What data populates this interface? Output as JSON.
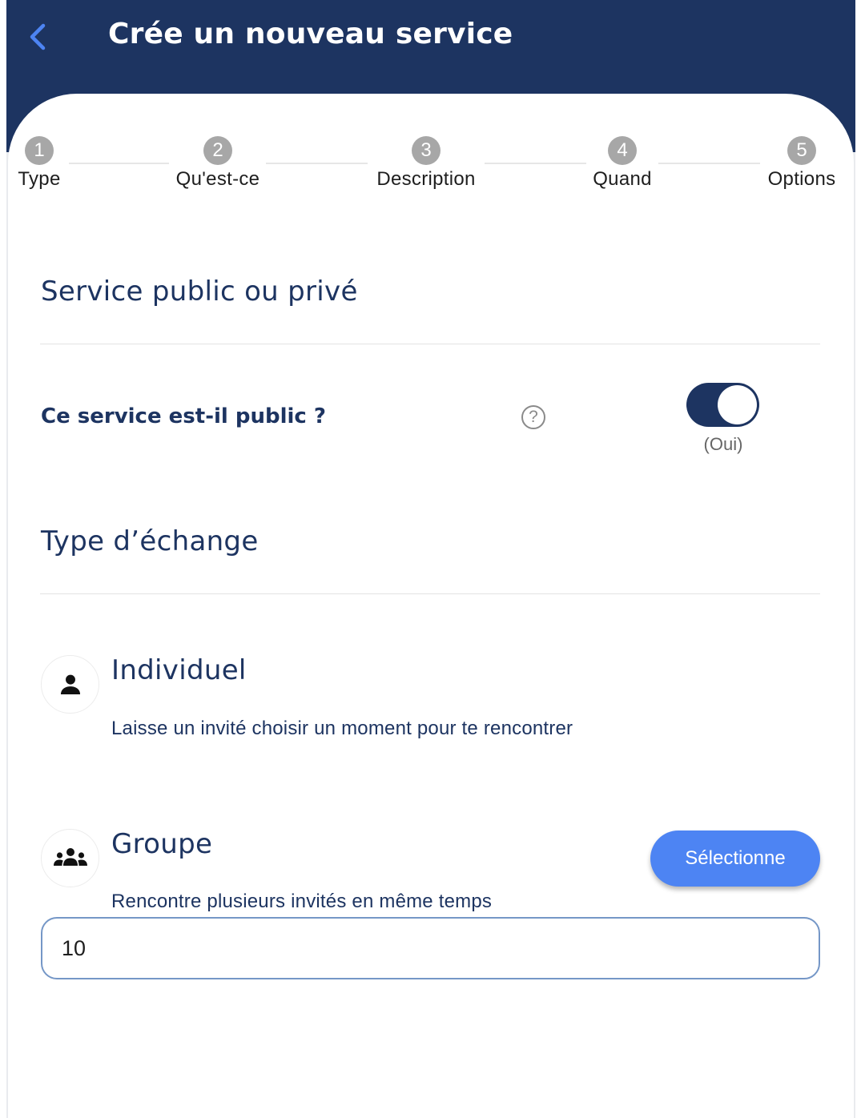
{
  "header": {
    "title": "Crée un nouveau service",
    "back_icon": "chevron-left-icon",
    "background": "#1d3461",
    "back_color": "#4d84f3"
  },
  "stepper": {
    "steps": [
      {
        "number": "1",
        "label": "Type"
      },
      {
        "number": "2",
        "label": "Qu'est-ce"
      },
      {
        "number": "3",
        "label": "Description"
      },
      {
        "number": "4",
        "label": "Quand"
      },
      {
        "number": "5",
        "label": "Options"
      }
    ]
  },
  "visibility": {
    "section_title": "Service public ou privé",
    "question": "Ce service est-il public ?",
    "help_icon": "help-circle-icon",
    "help_symbol": "?",
    "toggle_on": true,
    "toggle_state": "(Oui)"
  },
  "exchange": {
    "section_title": "Type d’échange",
    "options": [
      {
        "title": "Individuel",
        "description": "Laisse un invité choisir un moment pour te rencontrer",
        "icon": "person-icon"
      },
      {
        "title": "Groupe",
        "description": "Rencontre plusieurs invités en même temps",
        "icon": "group-icon",
        "button_label": "Sélectionne"
      }
    ],
    "capacity_value": "10"
  },
  "colors": {
    "primary": "#1d3461",
    "accent": "#4d84f3",
    "step_inactive": "#a7a7a7"
  }
}
